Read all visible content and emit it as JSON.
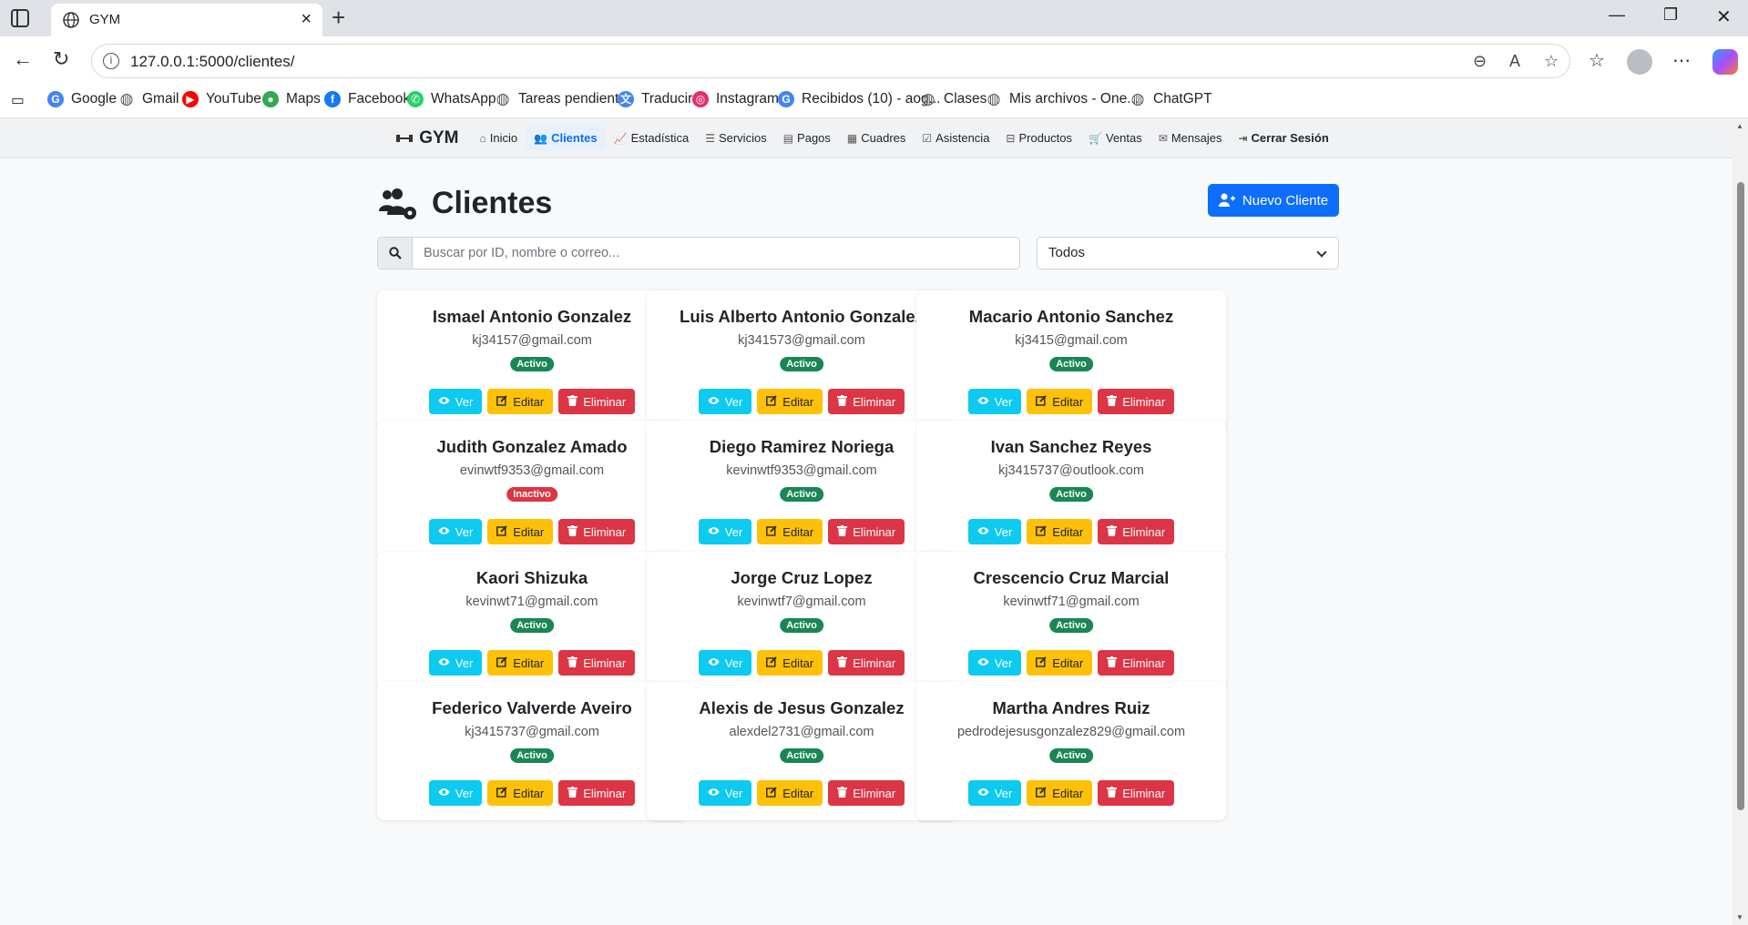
{
  "browser": {
    "tab_title": "GYM",
    "url": "127.0.0.1:5000/clientes/",
    "bookmarks": [
      {
        "label": "Google",
        "icon": "google-icon",
        "color": "#4285f4"
      },
      {
        "label": "Gmail",
        "icon": "globe-icon",
        "color": "#555555"
      },
      {
        "label": "YouTube",
        "icon": "youtube-icon",
        "color": "#ff0000"
      },
      {
        "label": "Maps",
        "icon": "maps-pin-icon",
        "color": "#34a853"
      },
      {
        "label": "Facebook",
        "icon": "facebook-icon",
        "color": "#1877f2"
      },
      {
        "label": "WhatsApp",
        "icon": "whatsapp-icon",
        "color": "#25d366"
      },
      {
        "label": "Tareas pendientes",
        "icon": "globe-icon",
        "color": "#555555"
      },
      {
        "label": "Traducir",
        "icon": "translate-icon",
        "color": "#4285f4"
      },
      {
        "label": "Instagram",
        "icon": "instagram-icon",
        "color": "#e1306c"
      },
      {
        "label": "Recibidos (10) - aog...",
        "icon": "google-icon",
        "color": "#4285f4"
      },
      {
        "label": "Clases",
        "icon": "globe-icon",
        "color": "#555555"
      },
      {
        "label": "Mis archivos - One...",
        "icon": "globe-icon",
        "color": "#555555"
      },
      {
        "label": "ChatGPT",
        "icon": "globe-icon",
        "color": "#555555"
      }
    ]
  },
  "app": {
    "brand": "GYM",
    "nav": [
      {
        "label": "Inicio",
        "icon": "home-icon",
        "active": false
      },
      {
        "label": "Clientes",
        "icon": "people-icon",
        "active": true
      },
      {
        "label": "Estadística",
        "icon": "chart-line-icon",
        "active": false
      },
      {
        "label": "Servicios",
        "icon": "list-icon",
        "active": false
      },
      {
        "label": "Pagos",
        "icon": "cash-icon",
        "active": false
      },
      {
        "label": "Cuadres",
        "icon": "cash-stack-icon",
        "active": false
      },
      {
        "label": "Asistencia",
        "icon": "calendar-check-icon",
        "active": false
      },
      {
        "label": "Productos",
        "icon": "basket-icon",
        "active": false
      },
      {
        "label": "Ventas",
        "icon": "cart-icon",
        "active": false
      },
      {
        "label": "Mensajes",
        "icon": "envelope-icon",
        "active": false
      },
      {
        "label": "Cerrar Sesión",
        "icon": "logout-icon",
        "active": false,
        "bold": true
      }
    ]
  },
  "page": {
    "title": "Clientes",
    "new_button": "Nuevo Cliente",
    "search_placeholder": "Buscar por ID, nombre o correo...",
    "filter_value": "Todos"
  },
  "actions": {
    "ver": "Ver",
    "editar": "Editar",
    "eliminar": "Eliminar"
  },
  "colors": {
    "primary": "#0d6efd",
    "info": "#0dcaf0",
    "warning": "#ffc107",
    "danger": "#dc3545",
    "success": "#198754"
  },
  "clients": [
    {
      "name": "Ismael Antonio Gonzalez",
      "email": "kj34157@gmail.com",
      "status": "Activo"
    },
    {
      "name": "Luis Alberto Antonio Gonzalez",
      "email": "kj341573@gmail.com",
      "status": "Activo"
    },
    {
      "name": "Macario Antonio Sanchez",
      "email": "kj3415@gmail.com",
      "status": "Activo"
    },
    {
      "name": "Judith Gonzalez Amado",
      "email": "evinwtf9353@gmail.com",
      "status": "Inactivo"
    },
    {
      "name": "Diego Ramirez Noriega",
      "email": "kevinwtf9353@gmail.com",
      "status": "Activo"
    },
    {
      "name": "Ivan Sanchez Reyes",
      "email": "kj3415737@outlook.com",
      "status": "Activo"
    },
    {
      "name": "Kaori Shizuka",
      "email": "kevinwt71@gmail.com",
      "status": "Activo"
    },
    {
      "name": "Jorge Cruz Lopez",
      "email": "kevinwtf7@gmail.com",
      "status": "Activo"
    },
    {
      "name": "Crescencio Cruz Marcial",
      "email": "kevinwtf71@gmail.com",
      "status": "Activo"
    },
    {
      "name": "Federico Valverde Aveiro",
      "email": "kj3415737@gmail.com",
      "status": "Activo"
    },
    {
      "name": "Alexis de Jesus Gonzalez",
      "email": "alexdel2731@gmail.com",
      "status": "Activo"
    },
    {
      "name": "Martha Andres Ruiz",
      "email": "pedrodejesusgonzalez829@gmail.com",
      "status": "Activo"
    }
  ]
}
